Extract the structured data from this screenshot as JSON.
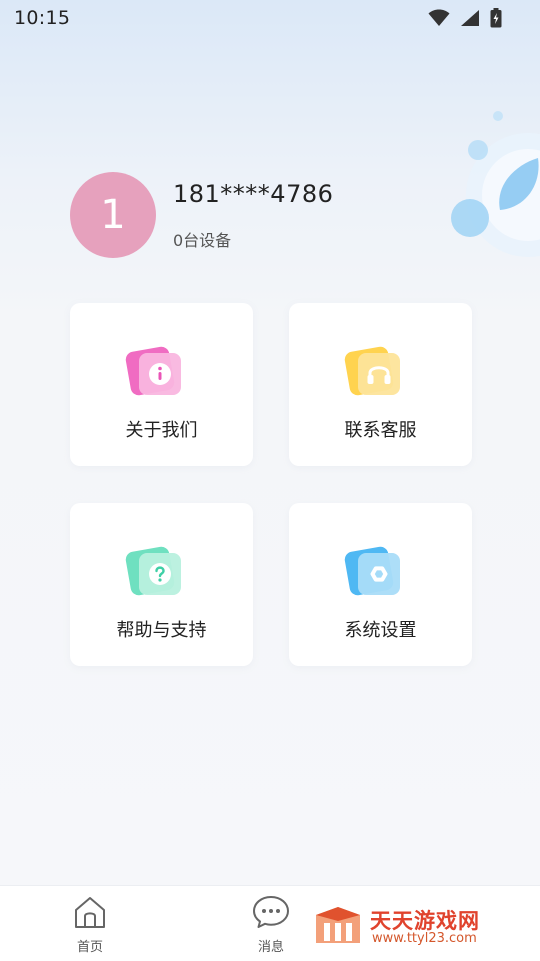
{
  "status_bar": {
    "time": "10:15",
    "icons": [
      "wifi-icon",
      "signal-icon",
      "battery-charging-icon"
    ]
  },
  "profile": {
    "avatar_text": "1",
    "avatar_color": "#e6a1bd",
    "phone": "181****4786",
    "device_count": "0台设备"
  },
  "menu": [
    {
      "label": "关于我们",
      "icon": "info-icon",
      "colors": [
        "#f277c6",
        "#e84fb5"
      ]
    },
    {
      "label": "联系客服",
      "icon": "headset-icon",
      "colors": [
        "#ffd75c",
        "#f5b52f"
      ]
    },
    {
      "label": "帮助与支持",
      "icon": "help-icon",
      "colors": [
        "#7ee6c8",
        "#3fcfa6"
      ]
    },
    {
      "label": "系统设置",
      "icon": "settings-icon",
      "colors": [
        "#6cc9f7",
        "#2ea7ee"
      ]
    }
  ],
  "bottom_nav": [
    {
      "label": "首页",
      "icon": "home-icon"
    },
    {
      "label": "消息",
      "icon": "chat-bubble-icon"
    }
  ],
  "watermark": {
    "title": "天天游戏网",
    "url": "www.ttyl23.com"
  }
}
